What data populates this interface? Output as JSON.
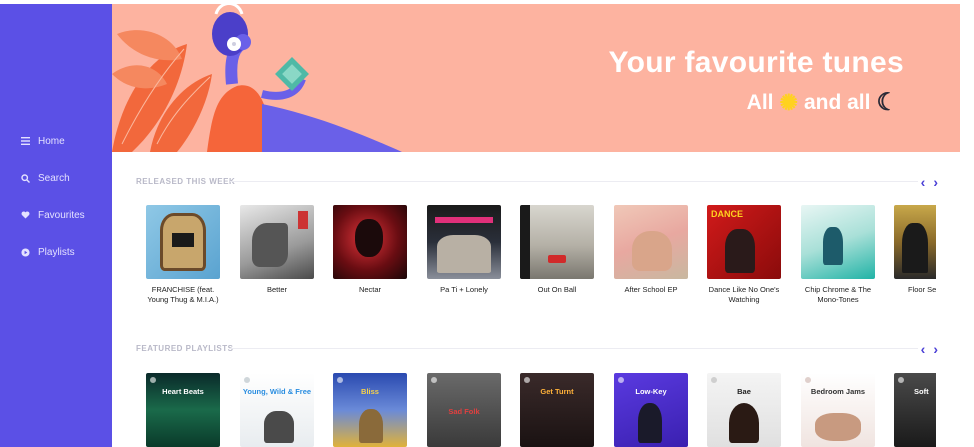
{
  "sidebar": {
    "items": [
      {
        "label": "Home",
        "icon": "menu-icon"
      },
      {
        "label": "Search",
        "icon": "search-icon"
      },
      {
        "label": "Favourites",
        "icon": "heart-icon"
      },
      {
        "label": "Playlists",
        "icon": "play-circle-icon"
      }
    ]
  },
  "hero": {
    "title": "Your favourite tunes",
    "subtitle_left": "All",
    "subtitle_right": "and all"
  },
  "released": {
    "title": "RELEASED THIS WEEK",
    "items": [
      {
        "title": "FRANCHISE (feat. Young Thug & M.I.A.)"
      },
      {
        "title": "Better"
      },
      {
        "title": "Nectar"
      },
      {
        "title": "Pa Ti + Lonely"
      },
      {
        "title": "Out On Ball"
      },
      {
        "title": "After School EP"
      },
      {
        "title": "Dance Like No One's Watching"
      },
      {
        "title": "Chip Chrome & The Mono-Tones"
      },
      {
        "title": "Floor Se"
      }
    ]
  },
  "featured": {
    "title": "FEATURED PLAYLISTS",
    "items": [
      {
        "title": "Heart Beats"
      },
      {
        "title": "Young, Wild & Free"
      },
      {
        "title": "Bliss"
      },
      {
        "title": "Sad Folk"
      },
      {
        "title": "Get Turnt"
      },
      {
        "title": "Low-Key"
      },
      {
        "title": "Bae"
      },
      {
        "title": "Bedroom Jams"
      },
      {
        "title": "Soft"
      }
    ]
  },
  "colors": {
    "sidebar": "#5b50e6",
    "hero": "#fdb3a0",
    "accent": "#4a3fd6"
  }
}
